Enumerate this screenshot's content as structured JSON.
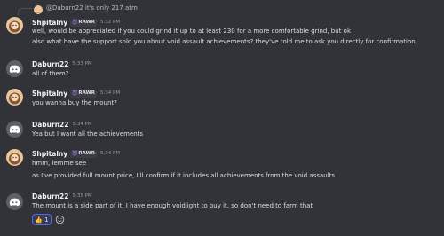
{
  "reply": {
    "text": "@Daburn22 it's only 217 atm"
  },
  "messages": [
    {
      "username": "Shpitalny",
      "tag": "RAWR",
      "time": "5:32 PM",
      "lines": [
        "well, would be appreciated if you could grind it up to at least 230 for a more comfortable grind, but ok",
        "also what have the support sold you about void assault achievements? they've told me to ask you directly for confirmation"
      ]
    },
    {
      "username": "Daburn22",
      "time": "5:33 PM",
      "lines": [
        "all of them?"
      ]
    },
    {
      "username": "Shpitalny",
      "tag": "RAWR",
      "time": "5:34 PM",
      "lines": [
        "you wanna buy the mount?"
      ]
    },
    {
      "username": "Daburn22",
      "time": "5:34 PM",
      "lines": [
        "Yea but I want all the achievements"
      ]
    },
    {
      "username": "Shpitalny",
      "tag": "RAWR",
      "time": "5:34 PM",
      "lines": [
        "hmm, lemme see",
        "as I've provided full mount price, I'll confirm if it includes all achievements from the void assaults"
      ]
    },
    {
      "username": "Daburn22",
      "time": "5:35 PM",
      "lines": [
        "The mount is a side part of it. I have enough voidlight to buy it. so don't need to farm that"
      ]
    }
  ],
  "reaction": {
    "emoji": "👍",
    "count": "1"
  },
  "colors": {
    "background": "#313338",
    "accent": "#5865f2",
    "tag_icon": "#b07cff"
  },
  "icons": {
    "tag": "demon-icon",
    "discord_avatar": "discord-logo-icon",
    "add_reaction": "smiley-icon"
  }
}
